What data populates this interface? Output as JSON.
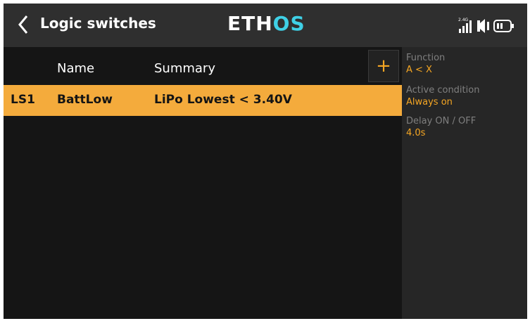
{
  "header": {
    "title": "Logic switches",
    "brand_left": "ETH",
    "brand_right": "OS",
    "radio_band": "2.4G",
    "icons": [
      "back-chevron-icon",
      "signal-icon",
      "speaker-icon",
      "battery-icon"
    ],
    "brand_color": "#3fd0e6"
  },
  "list": {
    "columns": [
      "Name",
      "Summary"
    ],
    "add_label": "+",
    "rows": [
      {
        "id": "LS1",
        "name": "BattLow",
        "summary": "LiPo Lowest < 3.40V",
        "selected": true
      }
    ]
  },
  "details": {
    "function_label": "Function",
    "function_value": "A < X",
    "active_label": "Active condition",
    "active_value": "Always on",
    "delay_label": "Delay ON / OFF",
    "delay_value": "4.0s"
  },
  "colors": {
    "accent": "#f5a623",
    "selection": "#f4ab3c",
    "background": "#151515",
    "panel": "#262626"
  }
}
